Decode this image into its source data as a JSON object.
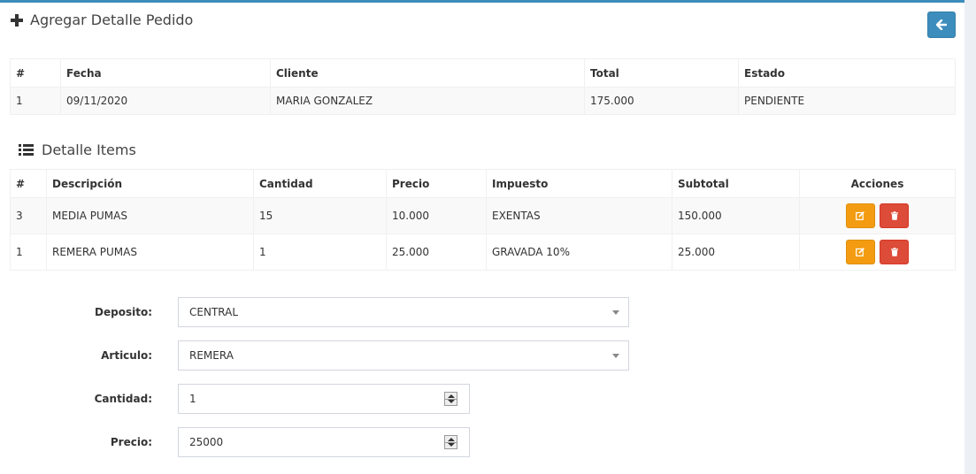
{
  "header": {
    "title": "Agregar Detalle Pedido"
  },
  "order_table": {
    "columns": [
      "#",
      "Fecha",
      "Cliente",
      "Total",
      "Estado"
    ],
    "rows": [
      [
        "1",
        "09/11/2020",
        "MARIA GONZALEZ",
        "175.000",
        "PENDIENTE"
      ]
    ]
  },
  "items_section": {
    "title": "Detalle Items"
  },
  "items_table": {
    "columns": [
      "#",
      "Descripción",
      "Cantidad",
      "Precio",
      "Impuesto",
      "Subtotal",
      "Acciones"
    ],
    "rows": [
      [
        "3",
        "MEDIA PUMAS",
        "15",
        "10.000",
        "EXENTAS",
        "150.000"
      ],
      [
        "1",
        "REMERA PUMAS",
        "1",
        "25.000",
        "GRAVADA 10%",
        "25.000"
      ]
    ]
  },
  "form": {
    "deposito": {
      "label": "Deposito:",
      "value": "CENTRAL"
    },
    "articulo": {
      "label": "Articulo:",
      "value": "REMERA"
    },
    "cantidad": {
      "label": "Cantidad:",
      "value": "1"
    },
    "precio": {
      "label": "Precio:",
      "value": "25000"
    }
  },
  "colors": {
    "primary": "#3c8dbc",
    "warning": "#f39c12",
    "danger": "#dd4b39"
  },
  "icons": {
    "header": "plus-icon",
    "back": "arrow-left-icon",
    "section": "list-icon",
    "edit": "edit-icon",
    "delete": "trash-icon"
  }
}
